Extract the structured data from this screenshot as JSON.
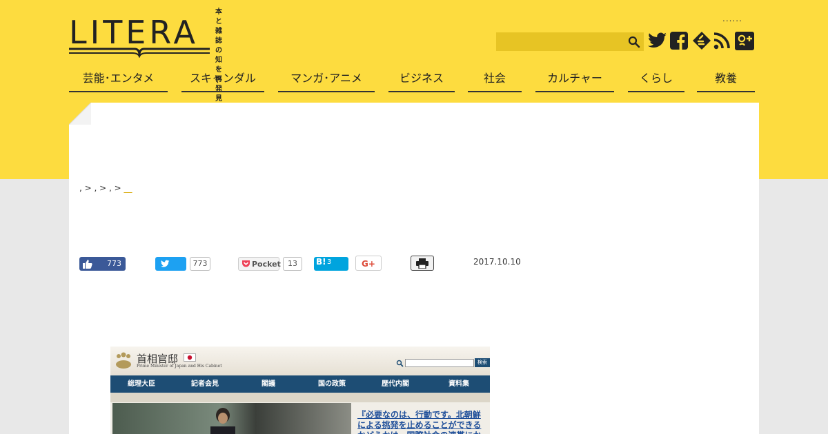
{
  "header": {
    "logo_text": "LITERA",
    "tagline_line1": "本と雑誌の",
    "tagline_line2": "知を再発見",
    "utility_dots": "......",
    "search": {
      "placeholder": "",
      "value": ""
    }
  },
  "nav": {
    "items": [
      {
        "label": "芸能･エンタメ"
      },
      {
        "label": "スキャンダル"
      },
      {
        "label": "マンガ･アニメ"
      },
      {
        "label": "ビジネス"
      },
      {
        "label": "社会"
      },
      {
        "label": "カルチャー"
      },
      {
        "label": "くらし"
      },
      {
        "label": "教養"
      }
    ]
  },
  "breadcrumb": {
    "text": ", > , > , >",
    "current": "__"
  },
  "share": {
    "like_count": "773",
    "tweet_count": "773",
    "pocket_label": "Pocket",
    "pocket_count": "13",
    "hatena_label": "B!",
    "hatena_count": "3",
    "gplus_label": "G+"
  },
  "article": {
    "date": "2017.10.10"
  },
  "screenshot": {
    "site_title": "首相官邸",
    "site_subtitle": "Prime Minister of Japan and His Cabinet",
    "search_button": "検索",
    "nav": [
      "総理大臣",
      "記者会見",
      "閣議",
      "国の政策",
      "歴代内閣",
      "資料集"
    ],
    "quote": "『必要なのは、行動です。北朝鮮による挑発を止めることができるかどうかは、国際社会の連帯にかかって"
  },
  "colors": {
    "brand_yellow": "#fddc3f",
    "nav_border": "#333333",
    "facebook": "#3b5998",
    "twitter": "#1da1f2"
  }
}
